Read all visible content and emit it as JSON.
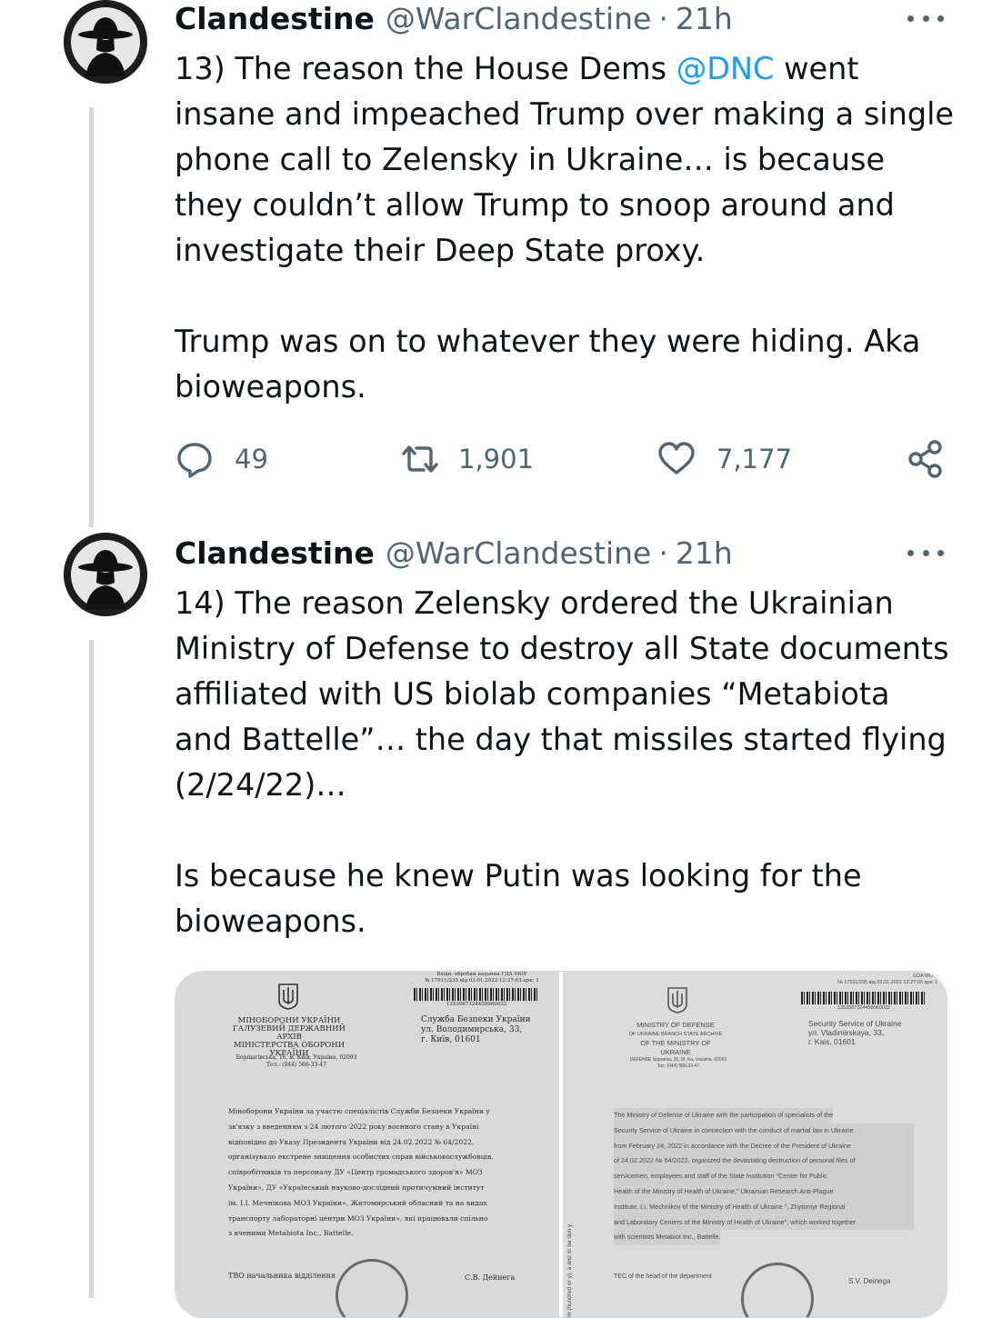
{
  "tweets": [
    {
      "author": {
        "name": "Clandestine",
        "handle": "@WarClandestine",
        "time": "21h",
        "avatar": "spy-silhouette-icon"
      },
      "text": {
        "p1_before": "13) The reason the House Dems ",
        "mention": "@DNC",
        "p1_after": " went insane and impeached Trump over making a single phone call to Zelensky in Ukraine… is because they couldn’t allow Trump to snoop around and investigate their Deep State proxy.",
        "p2": "Trump was on to whatever they were hiding. Aka bioweapons."
      },
      "stats": {
        "replies": "49",
        "retweets": "1,901",
        "likes": "7,177"
      }
    },
    {
      "author": {
        "name": "Clandestine",
        "handle": "@WarClandestine",
        "time": "21h",
        "avatar": "spy-silhouette-icon"
      },
      "text": {
        "p1": "14) The reason Zelensky ordered the Ukrainian Ministry of Defense to destroy all State documents affiliated with US biolab companies “Metabiota and Battelle”… the day that missiles started flying (2/24/22)…",
        "p2": "Is because he knew Putin was looking for the bioweapons."
      },
      "media": {
        "left": {
          "header_left": [
            "МІНОБОРОНИ УКРАЇНИ",
            "ГАЛУЗЕВИЙ ДЕРЖАВНИЙ АРХІВ",
            "МІНІСТЕРСТВА ОБОРОНИ",
            "УКРАЇНИ"
          ],
          "address_left": "Борщагівська, 16, м. Київ, Україна, 02093",
          "phone_left": "Тел.: (044) 566-33-47",
          "stamp_top": "Вхідн. обробки надання ГДА МОУ",
          "stamp_num": "№ 17911/235   від 03.01.2022 12:27:03 арк: 1",
          "barcode_num": "1353987324458960032",
          "recipient": [
            "Служба Безпеки України",
            "ул. Володимирська, 33,",
            "г. Київ, 01601"
          ],
          "body_lines": [
            "Міноборони України за участю спеціалістів Служби Безпеки України у",
            "зв'язку з введенням з 24 лютого 2022 року воєнного стану в Україні",
            "відповідно до Указу Президента України від 24.02.2022 № 64/2022,",
            "організувало екстрене знищення особистих справ військовослужбовців,",
            "співробітників та персоналу ДУ «Центр громадського здоров'я» МОЗ",
            "України», ДУ «Український науково-дослідний протичумний інститут",
            "ім. І.І. Мечнікова МОЗ України», Житомирський обласний та на видах",
            "транспорту лабораторні центри МОЗ України», які працювали спільно",
            "з вченими Metabiota Inc., Battelle."
          ],
          "footer_left": "ТВО начальника відділення",
          "footer_right": "С.В. Дейнега"
        },
        "right": {
          "header_left": [
            "MINISTRY OF DEFENSE",
            "OF UKRAINE BRANCH STATE ARCHIVE",
            "OF THE MINISTRY OF",
            "UKRAINE"
          ],
          "address_left": "DEFENSE Sоргаnia, 16, M. Ka, Vscaina. 02093",
          "phone_left": "Tax: (044) 566-33-47",
          "stamp_top": "GDA MO У",
          "stamp_num": "№ 17911/235   від 03.01.2022 12:27:03 арк: 1",
          "barcode_num": "1353987324458960032",
          "recipient": [
            "Security Service of Ukraine",
            "ул. Vladimirskaya, 33,",
            "г. Kais, 01601"
          ],
          "body_lines": [
            "The Ministry of Defense of Ukraine with the participation of specialists of the",
            "Security Service of Ukraine in connection with the conduct of martial law in Ukraine",
            "from February 24, 2022 in accordance with the Decree of the President of Ukraine",
            "of 24.02.2022 № 64/2022. organized the devastating destruction of personal files of",
            "servicemen, employees and staff of the State Institution \"Center for Public",
            "Health of the Ministry of Health of Ukraine,\" Ukrainian Research Anti-Plague",
            "Institute. I.I. Mechnikov of the Ministry of Health of Ukraine \", Zhytomyr Regional",
            "and Laboratory Centers of the Ministry of Health of Ukraine\", which worked together",
            "with scientists Metabiot Inc., Battelle."
          ],
          "side_note": "m (hundred or y), a and or ba don y",
          "footer_left": "TEC of the head of the department",
          "footer_right": "S.V. Deinega"
        }
      }
    }
  ]
}
